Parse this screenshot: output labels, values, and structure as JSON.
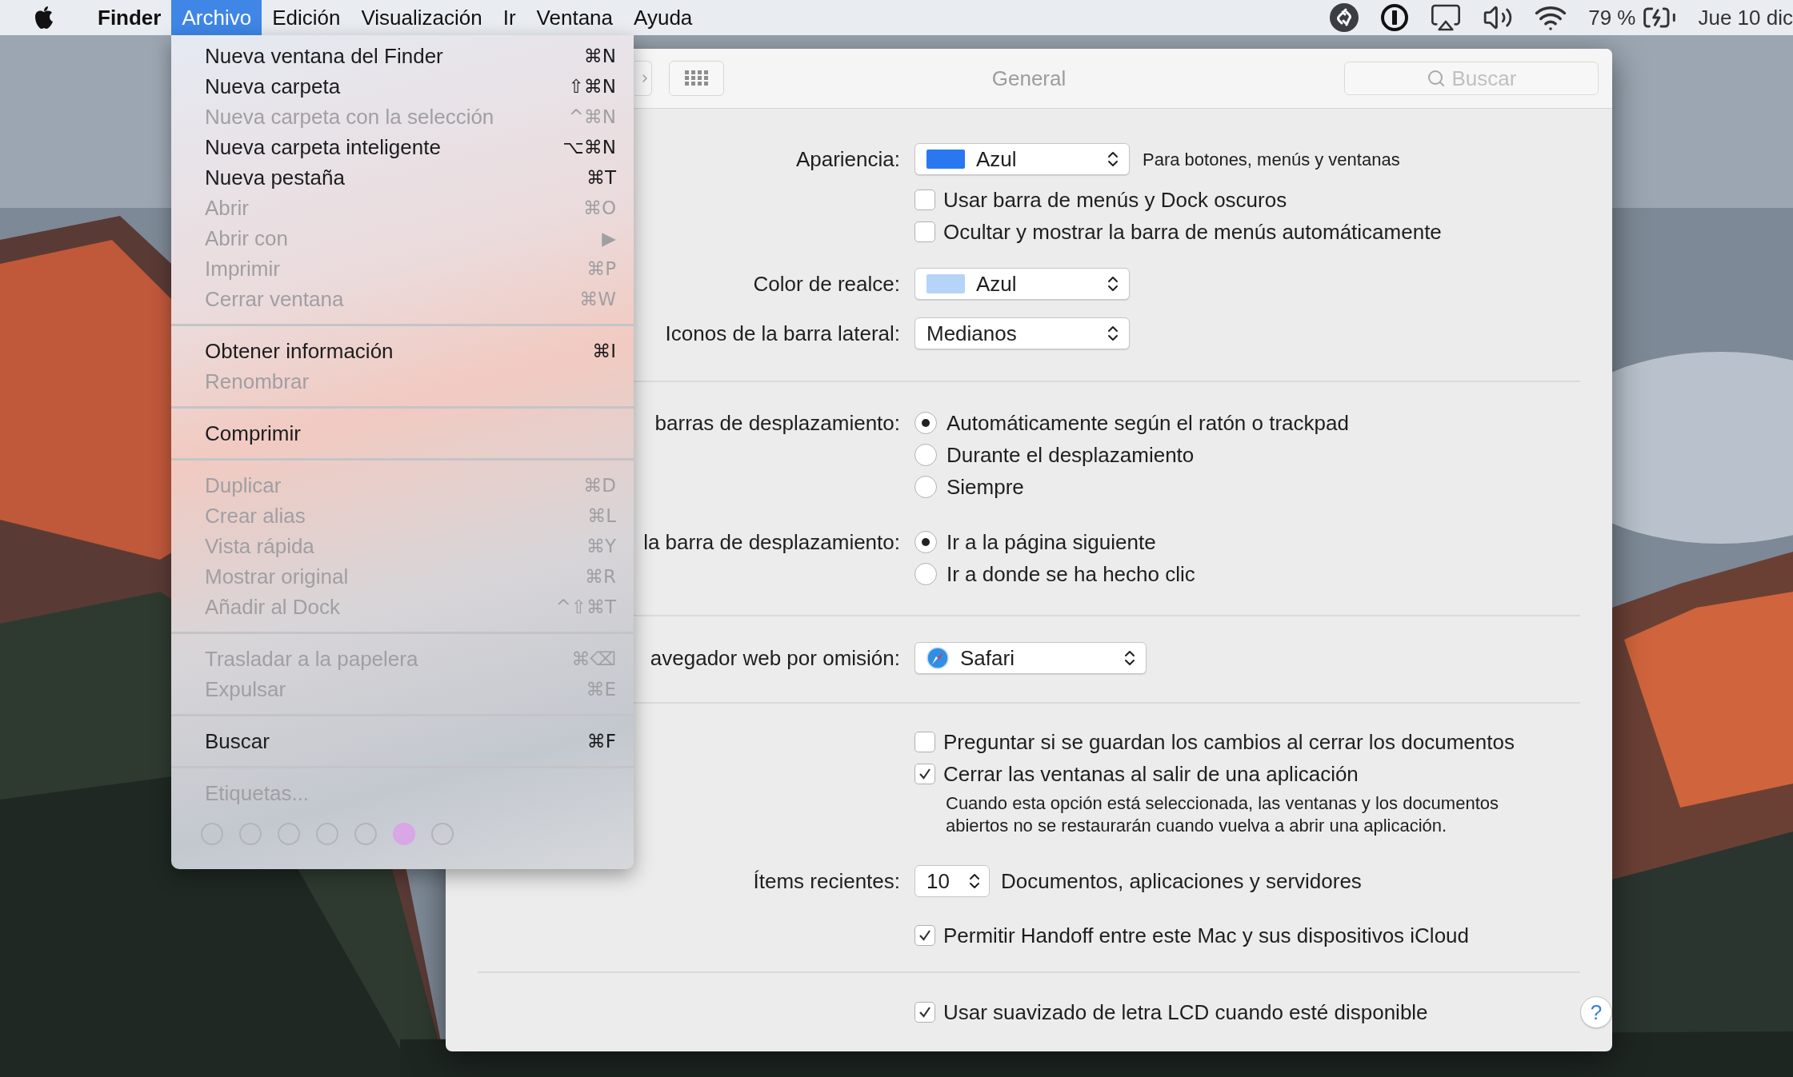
{
  "menu_bar": {
    "items": [
      {
        "label": "Finder",
        "kind": "app",
        "selected": false
      },
      {
        "label": "Archivo",
        "kind": "menu",
        "selected": true
      },
      {
        "label": "Edición",
        "kind": "menu",
        "selected": false
      },
      {
        "label": "Visualización",
        "kind": "menu",
        "selected": false
      },
      {
        "label": "Ir",
        "kind": "menu",
        "selected": false
      },
      {
        "label": "Ventana",
        "kind": "menu",
        "selected": false
      },
      {
        "label": "Ayuda",
        "kind": "menu",
        "selected": false
      }
    ],
    "battery": "79 %",
    "clock": "Jue 10 dic"
  },
  "file_menu": {
    "groups": [
      {
        "items": [
          {
            "label": "Nueva ventana del Finder",
            "shortcut": "⌘N",
            "disabled": false
          },
          {
            "label": "Nueva carpeta",
            "shortcut": "⇧⌘N",
            "disabled": false
          },
          {
            "label": "Nueva carpeta con la selección",
            "shortcut": "^⌘N",
            "disabled": true
          },
          {
            "label": "Nueva carpeta inteligente",
            "shortcut": "⌥⌘N",
            "disabled": false
          },
          {
            "label": "Nueva pestaña",
            "shortcut": "⌘T",
            "disabled": false
          },
          {
            "label": "Abrir",
            "shortcut": "⌘O",
            "disabled": true
          },
          {
            "label": "Abrir con",
            "shortcut": "▶",
            "disabled": true
          },
          {
            "label": "Imprimir",
            "shortcut": "⌘P",
            "disabled": true
          },
          {
            "label": "Cerrar ventana",
            "shortcut": "⌘W",
            "disabled": true
          }
        ]
      },
      {
        "items": [
          {
            "label": "Obtener información",
            "shortcut": "⌘I",
            "disabled": false
          },
          {
            "label": "Renombrar",
            "disabled": true
          }
        ]
      },
      {
        "items": [
          {
            "label": "Comprimir",
            "disabled": false
          }
        ]
      },
      {
        "items": [
          {
            "label": "Duplicar",
            "shortcut": "⌘D",
            "disabled": true
          },
          {
            "label": "Crear alias",
            "shortcut": "⌘L",
            "disabled": true
          },
          {
            "label": "Vista rápida",
            "shortcut": "⌘Y",
            "disabled": true
          },
          {
            "label": "Mostrar original",
            "shortcut": "⌘R",
            "disabled": true
          },
          {
            "label": "Añadir al Dock",
            "shortcut": "^⇧⌘T",
            "disabled": true
          }
        ]
      },
      {
        "items": [
          {
            "label": "Trasladar a la papelera",
            "shortcut": "⌘⌫",
            "disabled": true
          },
          {
            "label": "Expulsar",
            "shortcut": "⌘E",
            "disabled": true
          }
        ]
      },
      {
        "items": [
          {
            "label": "Buscar",
            "shortcut": "⌘F",
            "disabled": false
          }
        ]
      },
      {
        "items": [
          {
            "label": "Etiquetas...",
            "disabled": true
          }
        ]
      }
    ],
    "tags": [
      {
        "color": "#b4b4b8",
        "filled": false
      },
      {
        "color": "#b4b4b8",
        "filled": false
      },
      {
        "color": "#b4b4b8",
        "filled": false
      },
      {
        "color": "#b4b4b8",
        "filled": false
      },
      {
        "color": "#b4b4b8",
        "filled": false
      },
      {
        "color": "#d9a6e6",
        "filled": true
      },
      {
        "color": "#b4b4b8",
        "filled": false
      }
    ]
  },
  "window": {
    "title": "General",
    "search": {
      "placeholder": "Buscar"
    },
    "sections": [
      {
        "rows": [
          {
            "kind": "popup",
            "label": "Apariencia:",
            "value": "Azul",
            "color": "#2a78f0",
            "note": "Para botones, menús y ventanas"
          },
          {
            "kind": "checkbox",
            "text": "Usar barra de menús y Dock oscuros",
            "checked": false
          },
          {
            "kind": "checkbox",
            "text": "Ocultar y mostrar la barra de menús automáticamente",
            "checked": false
          },
          {
            "kind": "popup",
            "label": "Color de realce:",
            "value": "Azul",
            "color": "#b5d4f8"
          },
          {
            "kind": "popup",
            "label": "Iconos de la barra lateral:",
            "value": "Medianos"
          }
        ]
      },
      {
        "rows": [
          {
            "kind": "radio_group",
            "label": "barras de desplazamiento:",
            "options": [
              {
                "text": "Automáticamente según el ratón o trackpad",
                "selected": true
              },
              {
                "text": "Durante el desplazamiento",
                "selected": false
              },
              {
                "text": "Siempre",
                "selected": false
              }
            ]
          },
          {
            "kind": "radio_group",
            "label": "la barra de desplazamiento:",
            "options": [
              {
                "text": "Ir a la página siguiente",
                "selected": true
              },
              {
                "text": "Ir a donde se ha hecho clic",
                "selected": false
              }
            ]
          }
        ]
      },
      {
        "rows": [
          {
            "kind": "app_popup",
            "label": "avegador web por omisión:",
            "value": "Safari"
          }
        ]
      },
      {
        "rows": [
          {
            "kind": "checkbox",
            "text": "Preguntar si se guardan los cambios al cerrar los documentos",
            "checked": false
          },
          {
            "kind": "checkbox",
            "text": "Cerrar las ventanas al salir de una aplicación",
            "checked": true
          },
          {
            "kind": "note",
            "lines": [
              "Cuando esta opción está seleccionada, las ventanas y los documentos",
              "abiertos no se restaurarán cuando vuelva a abrir una aplicación."
            ]
          },
          {
            "kind": "stepper",
            "label": "Ítems recientes:",
            "value": "10",
            "note": "Documentos, aplicaciones y servidores"
          },
          {
            "kind": "checkbox",
            "text": "Permitir Handoff entre este Mac y sus dispositivos iCloud",
            "checked": true
          }
        ]
      },
      {
        "rows": [
          {
            "kind": "checkbox",
            "text": "Usar suavizado de letra LCD cuando esté disponible",
            "checked": true,
            "help": "?"
          }
        ]
      }
    ]
  }
}
